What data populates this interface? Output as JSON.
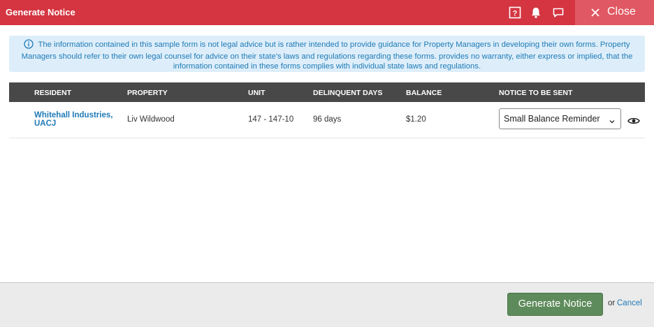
{
  "header": {
    "title": "Generate Notice",
    "icons": [
      "help-icon",
      "bell-icon",
      "chat-icon"
    ],
    "close_label": "Close"
  },
  "info": {
    "icon": "info-icon",
    "text": "The information contained in this sample form is not legal advice but is rather intended to provide guidance for Property Managers in developing their own forms. Property Managers should refer to their own legal counsel for advice on their state's laws and regulations regarding these forms. provides no warranty, either express or implied, that the information contained in these forms complies with individual state laws and regulations."
  },
  "table": {
    "columns": [
      "RESIDENT",
      "PROPERTY",
      "UNIT",
      "DELINQUENT DAYS",
      "BALANCE",
      "NOTICE TO BE SENT"
    ],
    "rows": [
      {
        "resident": "Whitehall Industries, UACJ",
        "property": "Liv Wildwood",
        "unit": "147 - 147-10",
        "delinquent_days": "96 days",
        "balance": "$1.20",
        "notice": "Small Balance Reminder"
      }
    ]
  },
  "footer": {
    "generate_label": "Generate Notice",
    "or_text": "or",
    "cancel_label": "Cancel"
  },
  "colors": {
    "header_bg": "#d43541",
    "close_bg": "#e05863",
    "info_bg": "#ddeefa",
    "link": "#1f7ab6",
    "table_header_bg": "#484848",
    "primary_button": "#5e8b5b"
  }
}
